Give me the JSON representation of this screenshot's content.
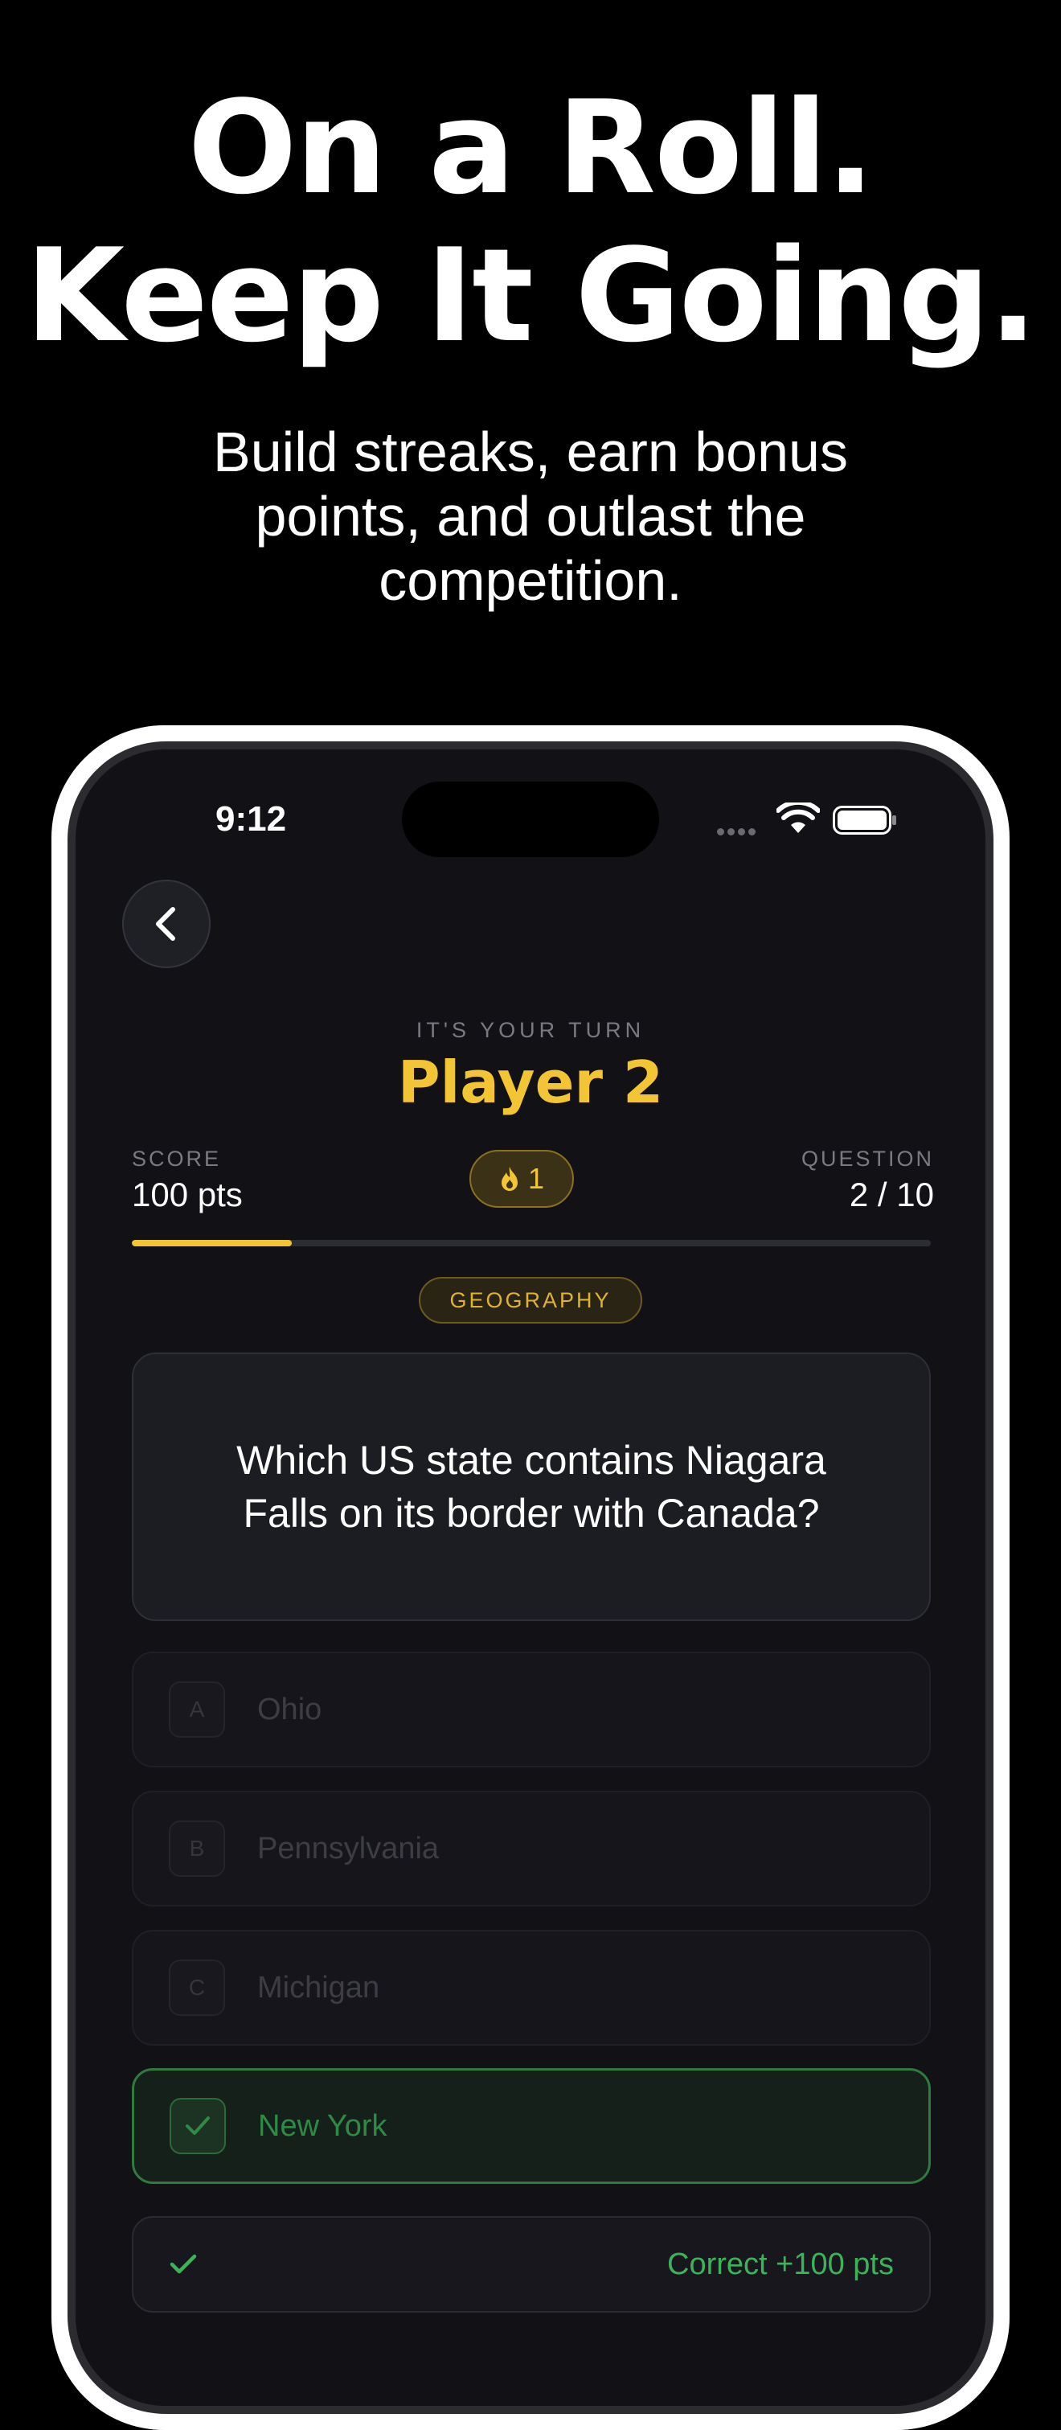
{
  "marketing": {
    "headline_line1": "On a Roll.",
    "headline_line2": "Keep It Going.",
    "subheadline": "Build streaks, earn bonus points, and outlast the competition."
  },
  "status_bar": {
    "time": "9:12"
  },
  "game": {
    "turn_label": "IT'S YOUR TURN",
    "player_name": "Player 2",
    "score_label": "SCORE",
    "score_value": "100 pts",
    "question_label": "QUESTION",
    "question_count": "2 / 10",
    "streak_count": "1",
    "progress_fraction": 0.2,
    "category": "GEOGRAPHY",
    "question": "Which US state contains Niagara Falls on its border with Canada?",
    "answers": [
      {
        "letter": "A",
        "label": "Ohio",
        "state": "dimmed"
      },
      {
        "letter": "B",
        "label": "Pennsylvania",
        "state": "dimmed"
      },
      {
        "letter": "C",
        "label": "Michigan",
        "state": "dimmed"
      },
      {
        "letter": "✓",
        "label": "New York",
        "state": "correct"
      }
    ],
    "result_text": "Correct +100 pts"
  },
  "colors": {
    "accent_gold": "#f3c434",
    "correct_green": "#3cb35a",
    "background": "#000000",
    "screen_bg": "#121216"
  },
  "icons": [
    "chevron-left-icon",
    "flame-icon",
    "checkmark-icon",
    "wifi-icon",
    "battery-icon",
    "signal-dots-icon"
  ]
}
